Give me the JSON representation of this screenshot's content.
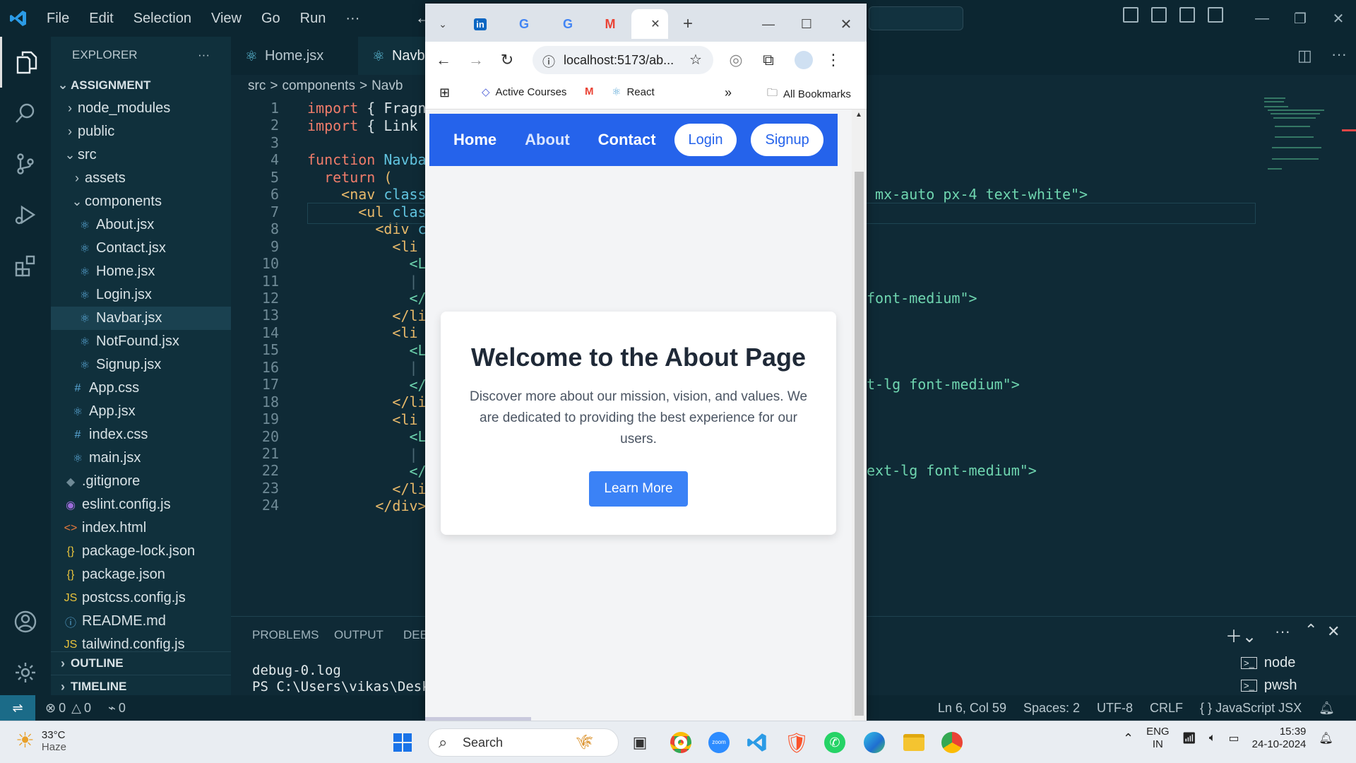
{
  "vscode": {
    "menu": [
      "File",
      "Edit",
      "Selection",
      "View",
      "Go",
      "Run",
      "···"
    ],
    "explorer": {
      "title": "EXPLORER",
      "more": "···",
      "root": "ASSIGNMENT",
      "items": [
        {
          "label": "node_modules",
          "type": "folder",
          "depth": 1,
          "icon": ">"
        },
        {
          "label": "public",
          "type": "folder",
          "depth": 1,
          "icon": ">"
        },
        {
          "label": "src",
          "type": "folder-open",
          "depth": 1,
          "icon": "v"
        },
        {
          "label": "assets",
          "type": "folder",
          "depth": 2,
          "icon": ">"
        },
        {
          "label": "components",
          "type": "folder-open",
          "depth": 2,
          "icon": "v"
        },
        {
          "label": "About.jsx",
          "type": "react",
          "depth": 3
        },
        {
          "label": "Contact.jsx",
          "type": "react",
          "depth": 3
        },
        {
          "label": "Home.jsx",
          "type": "react",
          "depth": 3
        },
        {
          "label": "Login.jsx",
          "type": "react",
          "depth": 3
        },
        {
          "label": "Navbar.jsx",
          "type": "react",
          "depth": 3,
          "selected": true
        },
        {
          "label": "NotFound.jsx",
          "type": "react",
          "depth": 3
        },
        {
          "label": "Signup.jsx",
          "type": "react",
          "depth": 3
        },
        {
          "label": "App.css",
          "type": "css",
          "depth": 2
        },
        {
          "label": "App.jsx",
          "type": "react",
          "depth": 2
        },
        {
          "label": "index.css",
          "type": "css",
          "depth": 2
        },
        {
          "label": "main.jsx",
          "type": "react",
          "depth": 2
        },
        {
          "label": ".gitignore",
          "type": "git",
          "depth": 1
        },
        {
          "label": "eslint.config.js",
          "type": "eslint",
          "depth": 1
        },
        {
          "label": "index.html",
          "type": "html",
          "depth": 1
        },
        {
          "label": "package-lock.json",
          "type": "json",
          "depth": 1
        },
        {
          "label": "package.json",
          "type": "json",
          "depth": 1
        },
        {
          "label": "postcss.config.js",
          "type": "js",
          "depth": 1
        },
        {
          "label": "README.md",
          "type": "info",
          "depth": 1
        },
        {
          "label": "tailwind.config.js",
          "type": "js",
          "depth": 1
        }
      ],
      "outline": "OUTLINE",
      "timeline": "TIMELINE"
    },
    "tabs": [
      "Home.jsx",
      "Navb"
    ],
    "breadcrumbs": [
      "src",
      ">",
      "components",
      ">",
      "Navb"
    ],
    "line_numbers": [
      "1",
      "2",
      "3",
      "4",
      "5",
      "6",
      "7",
      "8",
      "9",
      "10",
      "11",
      "12",
      "13",
      "14",
      "15",
      "16",
      "17",
      "18",
      "19",
      "20",
      "21",
      "22",
      "23",
      "24"
    ],
    "code_left": {
      "l1a": "import",
      "l1b": " { Fragn",
      "l2a": "import",
      "l2b": " { Link",
      "l4a": "function",
      "l4b": " Navba",
      "l5a": "  return",
      "l5b": " (",
      "l6a": "    <nav",
      "l6b": " class",
      "l7a": "      <ul",
      "l7b": " clas",
      "l8a": "        <div",
      "l8b": " c",
      "l9": "          <li",
      "l10": "            <L",
      "l11": "            |",
      "l12": "            </",
      "l13": "          </li",
      "l14": "          <li",
      "l15": "            <L",
      "l16": "            |",
      "l17": "            </",
      "l18": "          </li",
      "l19": "          <li",
      "l20": "            <L",
      "l21": "            |",
      "l22": "            </",
      "l23": "          </li",
      "l24": "        </div>"
    },
    "code_right": {
      "r7": " mx-auto px-4 text-white\">",
      "r10": "font-medium\">",
      "r15": "t-lg font-medium\">",
      "r20": "ext-lg font-medium\">"
    },
    "panel": {
      "tabs": [
        "PROBLEMS",
        "OUTPUT",
        "DEB"
      ],
      "terminal_lines": [
        "debug-0.log",
        "PS C:\\Users\\vikas\\Deskt"
      ],
      "terminals": [
        "node",
        "pwsh"
      ]
    },
    "status": {
      "errors": "0",
      "warnings": "0",
      "ports": "0",
      "position": "Ln 6, Col 59",
      "spaces": "Spaces: 2",
      "encoding": "UTF-8",
      "eol": "CRLF",
      "language": "JavaScript JSX"
    }
  },
  "browser": {
    "url": "localhost:5173/ab...",
    "bookmarks": [
      "Active Courses",
      "React",
      "All Bookmarks"
    ],
    "site": {
      "nav": [
        "Home",
        "About",
        "Contact"
      ],
      "login": "Login",
      "signup": "Signup",
      "heading": "Welcome to the About Page",
      "body": "Discover more about our mission, vision, and values. We are dedicated to providing the best experience for our users.",
      "cta": "Learn More"
    },
    "colors": {
      "nav": "#2563eb",
      "cta": "#3b82f6"
    }
  },
  "taskbar": {
    "temp": "33°C",
    "weather": "Haze",
    "search": "Search",
    "lang1": "ENG",
    "lang2": "IN",
    "time": "15:39",
    "date": "24-10-2024"
  }
}
